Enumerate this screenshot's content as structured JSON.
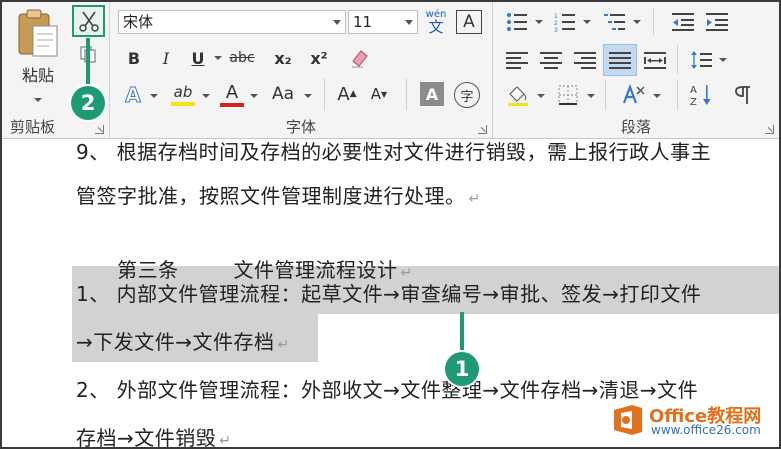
{
  "ribbon": {
    "clipboard": {
      "group_label": "剪贴板",
      "paste_label": "粘贴"
    },
    "font": {
      "group_label": "字体",
      "font_name": "宋体",
      "font_size": "11",
      "phonetic_glyph": "文",
      "phonetic_top": "wén",
      "border_glyph": "A",
      "bold": "B",
      "italic": "I",
      "underline": "U",
      "strike": "abc",
      "subscript": "x₂",
      "superscript": "x²",
      "text_effects": "A",
      "highlight": "ab",
      "font_color": "A",
      "change_case": "Aa",
      "grow": "A",
      "shrink": "A",
      "char_shading": "A",
      "enclose": "字"
    },
    "paragraph": {
      "group_label": "段落"
    }
  },
  "document": {
    "lines": [
      "9、 根据存档时间及存档的必要性对文件进行销毁，需上报行政人事主",
      "管签字批准，按照文件管理制度进行处理。",
      "第三条        文件管理流程设计",
      "1、 内部文件管理流程：起草文件→审查编号→审批、签发→打印文件",
      "→下发文件→文件存档",
      "2、 外部文件管理流程：外部收文→文件整理→文件存档→清退→文件",
      "存档→文件销毁"
    ],
    "paragraph_mark": "↵"
  },
  "callouts": {
    "one": "1",
    "two": "2"
  },
  "watermark": {
    "brand": "Office教程网",
    "url": "www.office26.com"
  },
  "colors": {
    "callout": "#1e9b74",
    "selection": "#d2d2d2",
    "watermark_brand": "#e2711d"
  }
}
